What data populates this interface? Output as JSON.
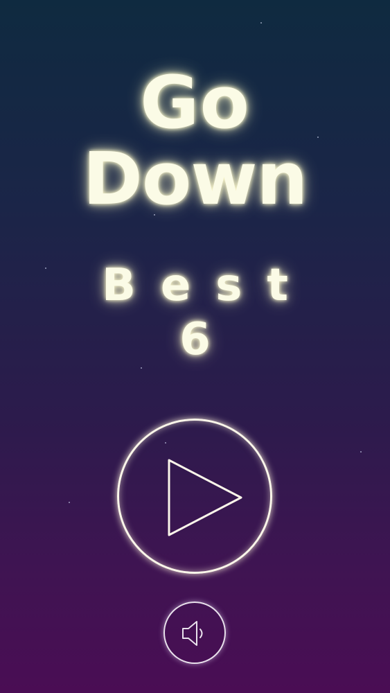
{
  "title": {
    "line1": "Go",
    "line2": "Down"
  },
  "best": {
    "label": "Best",
    "value": "6"
  },
  "controls": {
    "play_icon": "play-icon",
    "sound_icon": "speaker-icon"
  },
  "colors": {
    "background_top": "#0f2a40",
    "background_bottom": "#4a0d54",
    "glow_text": "#fbfbe6",
    "ring": "#fbf6ea"
  }
}
